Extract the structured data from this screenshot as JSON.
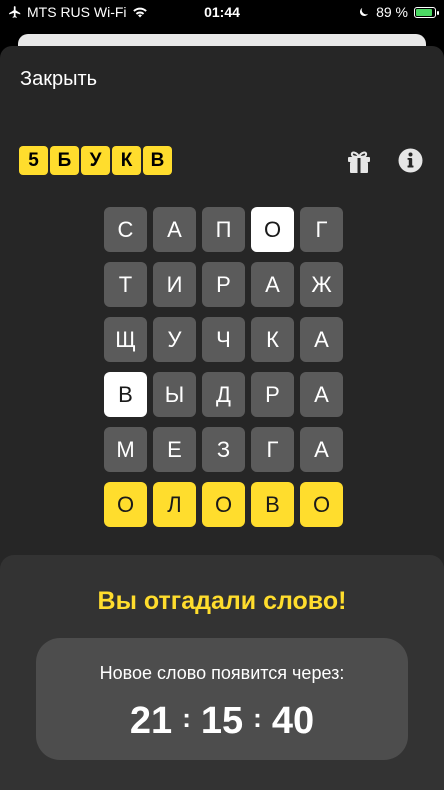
{
  "status_bar": {
    "carrier": "MTS RUS Wi-Fi",
    "time": "01:44",
    "battery": "89 %",
    "battery_level": 0.89
  },
  "header": {
    "close_label": "Закрыть",
    "logo_letters": [
      "5",
      "Б",
      "У",
      "К",
      "В"
    ]
  },
  "board": {
    "rows": [
      [
        {
          "letter": "С",
          "state": "gray"
        },
        {
          "letter": "А",
          "state": "gray"
        },
        {
          "letter": "П",
          "state": "gray"
        },
        {
          "letter": "О",
          "state": "white"
        },
        {
          "letter": "Г",
          "state": "gray"
        }
      ],
      [
        {
          "letter": "Т",
          "state": "gray"
        },
        {
          "letter": "И",
          "state": "gray"
        },
        {
          "letter": "Р",
          "state": "gray"
        },
        {
          "letter": "А",
          "state": "gray"
        },
        {
          "letter": "Ж",
          "state": "gray"
        }
      ],
      [
        {
          "letter": "Щ",
          "state": "gray"
        },
        {
          "letter": "У",
          "state": "gray"
        },
        {
          "letter": "Ч",
          "state": "gray"
        },
        {
          "letter": "К",
          "state": "gray"
        },
        {
          "letter": "А",
          "state": "gray"
        }
      ],
      [
        {
          "letter": "В",
          "state": "white"
        },
        {
          "letter": "Ы",
          "state": "gray"
        },
        {
          "letter": "Д",
          "state": "gray"
        },
        {
          "letter": "Р",
          "state": "gray"
        },
        {
          "letter": "А",
          "state": "gray"
        }
      ],
      [
        {
          "letter": "М",
          "state": "gray"
        },
        {
          "letter": "Е",
          "state": "gray"
        },
        {
          "letter": "З",
          "state": "gray"
        },
        {
          "letter": "Г",
          "state": "gray"
        },
        {
          "letter": "А",
          "state": "gray"
        }
      ],
      [
        {
          "letter": "О",
          "state": "yellow"
        },
        {
          "letter": "Л",
          "state": "yellow"
        },
        {
          "letter": "О",
          "state": "yellow"
        },
        {
          "letter": "В",
          "state": "yellow"
        },
        {
          "letter": "О",
          "state": "yellow"
        }
      ]
    ]
  },
  "result": {
    "title": "Вы отгадали слово!",
    "next_word_label": "Новое слово появится через:",
    "timer": {
      "hours": "21",
      "minutes": "15",
      "seconds": "40",
      "separator": ":"
    }
  },
  "colors": {
    "accent": "#ffdd2d",
    "tile_gray": "#5b5b5b",
    "tile_white": "#ffffff",
    "sheet_bg": "#262626",
    "panel_bg": "#333333"
  }
}
